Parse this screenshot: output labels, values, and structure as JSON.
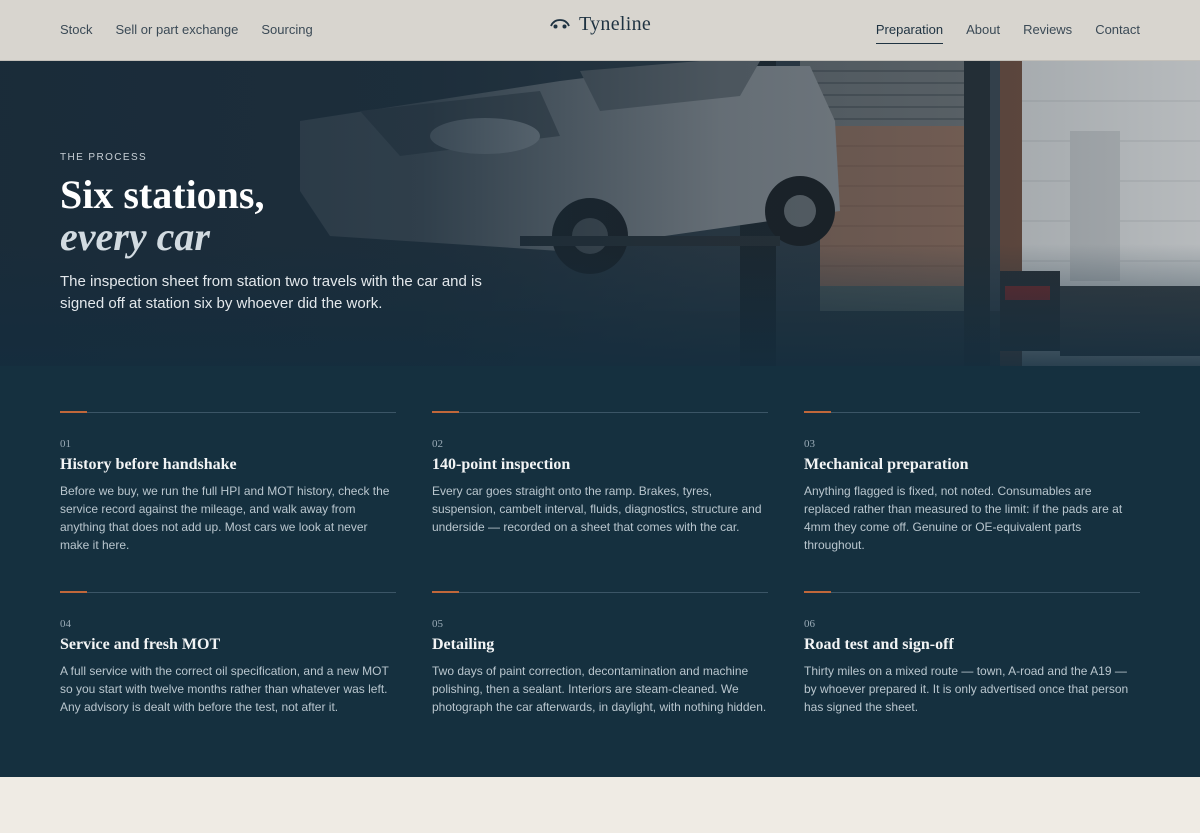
{
  "nav": {
    "left": [
      "Stock",
      "Sell or part exchange",
      "Sourcing"
    ],
    "brand": "Tyneline",
    "right": [
      "Preparation",
      "About",
      "Reviews",
      "Contact"
    ],
    "active": "Preparation"
  },
  "hero": {
    "eyebrow": "THE PROCESS",
    "title_line1": "Six stations,",
    "title_line2": "every car",
    "description": "The inspection sheet from station two travels with the car and is signed off at station six by whoever did the work."
  },
  "stations": [
    {
      "number": "01",
      "title": "History before handshake",
      "body": "Before we buy, we run the full HPI and MOT history, check the service record against the mileage, and walk away from anything that does not add up. Most cars we look at never make it here."
    },
    {
      "number": "02",
      "title": "140-point inspection",
      "body": "Every car goes straight onto the ramp. Brakes, tyres, suspension, cambelt interval, fluids, diagnostics, structure and underside — recorded on a sheet that comes with the car."
    },
    {
      "number": "03",
      "title": "Mechanical preparation",
      "body": "Anything flagged is fixed, not noted. Consumables are replaced rather than measured to the limit: if the pads are at 4mm they come off. Genuine or OE-equivalent parts throughout."
    },
    {
      "number": "04",
      "title": "Service and fresh MOT",
      "body": "A full service with the correct oil specification, and a new MOT so you start with twelve months rather than whatever was left. Any advisory is dealt with before the test, not after it."
    },
    {
      "number": "05",
      "title": "Detailing",
      "body": "Two days of paint correction, decontamination and machine polishing, then a sealant. Interiors are steam-cleaned. We photograph the car afterwards, in daylight, with nothing hidden."
    },
    {
      "number": "06",
      "title": "Road test and sign-off",
      "body": "Thirty miles on a mixed route — town, A-road and the A19 — by whoever prepared it. It is only advertised once that person has signed the sheet."
    }
  ],
  "colors": {
    "accent": "#c0673a",
    "section_bg": "#15303f",
    "page_bg": "#efebe4"
  },
  "icons": {
    "brand": "car-outline-icon"
  }
}
